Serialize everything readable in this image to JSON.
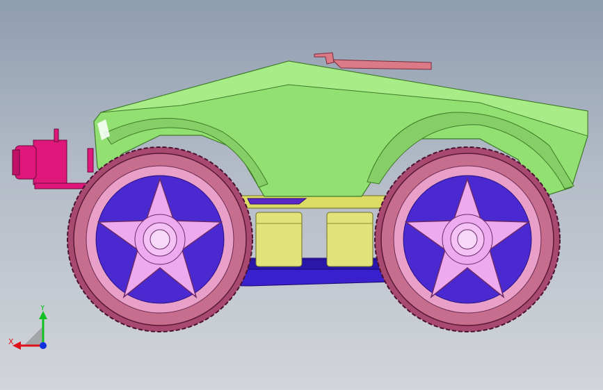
{
  "viewport": {
    "background_top": "#8f9db0",
    "background_bottom": "#d2d5da"
  },
  "model": {
    "body_color": "#92e072",
    "wheel_tire_color": "#c76e8e",
    "rim_color": "#eeaaee",
    "chassis_color": "#3b1fd0",
    "motor_color": "#e3e37a",
    "sensor_color": "#e0177a",
    "board_color": "#d97a86"
  },
  "triad": {
    "x_label": "X",
    "y_label": "Y",
    "x_color": "#e0101a",
    "y_color": "#10c020",
    "z_color": "#1030e0"
  }
}
